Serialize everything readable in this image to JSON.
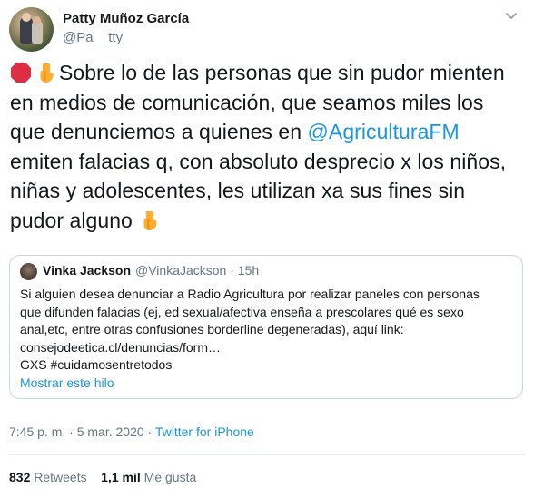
{
  "author": {
    "name": "Patty Muñoz García",
    "handle": "@Pa__tty"
  },
  "tweet": {
    "text_part1": "Sobre lo de las personas que sin pudor mienten en medios de comunicación, que seamos miles los que denunciemos a quienes en ",
    "mention": "@AgriculturaFM",
    "text_part2": " emiten falacias q, con absoluto desprecio x los niños, niñas y adolescentes, les utilizan xa sus fines sin pudor alguno",
    "emojis": [
      "stop-sign-icon",
      "pointing-down-icon"
    ]
  },
  "quoted": {
    "name": "Vinka Jackson",
    "handle": "@VinkaJackson",
    "time": "15h",
    "lines": [
      "Si alguien desea denunciar a Radio Agricultura por realizar paneles con personas",
      "que difunden falacias (ej, ed sexual/afectiva enseña a prescolares qué es sexo",
      "anal,etc, entre otras confusiones borderline degeneradas), aquí link:",
      "consejodeetica.cl/denuncias/form…",
      "GXS #cuidamosentretodos"
    ],
    "show_thread": "Mostrar este hilo"
  },
  "meta": {
    "time": "7:45 p. m.",
    "date": "5 mar. 2020",
    "separator": " · ",
    "source": "Twitter for iPhone"
  },
  "stats": {
    "retweets_count": "832",
    "retweets_label": "Retweets",
    "likes_count": "1,1 mil",
    "likes_label": "Me gusta"
  },
  "colors": {
    "accent": "#1b95e0",
    "muted": "#657786",
    "border": "#ccd6dd"
  }
}
